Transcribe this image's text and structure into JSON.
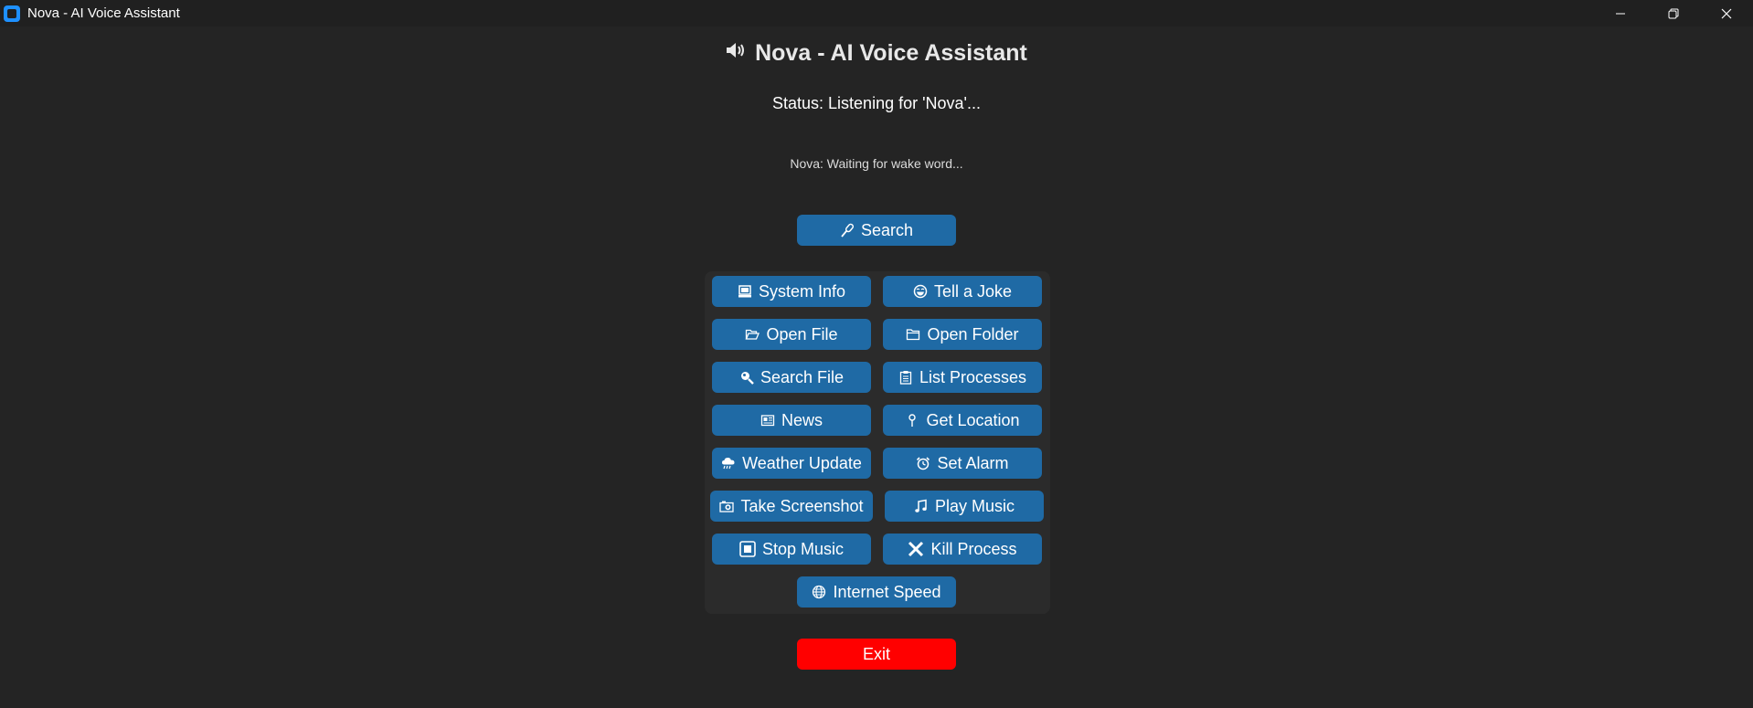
{
  "window": {
    "title": "Nova - AI Voice Assistant",
    "controls": [
      "minimize",
      "restore",
      "close"
    ]
  },
  "header": {
    "title": "Nova - AI Voice Assistant",
    "icon": "speaker-icon"
  },
  "status": "Status: Listening for 'Nova'...",
  "reply": "Nova: Waiting for wake word...",
  "search_button": {
    "label": "Search",
    "icon": "microphone-icon"
  },
  "commands": [
    {
      "label": "System Info",
      "icon": "computer-icon"
    },
    {
      "label": "Tell a Joke",
      "icon": "laughing-face-icon"
    },
    {
      "label": "Open File",
      "icon": "open-folder-icon"
    },
    {
      "label": "Open Folder",
      "icon": "folder-icon"
    },
    {
      "label": "Search File",
      "icon": "magnifier-icon"
    },
    {
      "label": "List Processes",
      "icon": "clipboard-icon"
    },
    {
      "label": "News",
      "icon": "newspaper-icon"
    },
    {
      "label": "Get Location",
      "icon": "pin-icon"
    },
    {
      "label": "Weather Update",
      "icon": "rain-cloud-icon"
    },
    {
      "label": "Set Alarm",
      "icon": "alarm-clock-icon"
    },
    {
      "label": "Take Screenshot",
      "icon": "camera-icon"
    },
    {
      "label": "Play Music",
      "icon": "music-note-icon"
    },
    {
      "label": "Stop Music",
      "icon": "stop-icon"
    },
    {
      "label": "Kill Process",
      "icon": "x-icon"
    },
    {
      "label": "Internet Speed",
      "icon": "globe-icon"
    }
  ],
  "exit_button": {
    "label": "Exit"
  },
  "colors": {
    "background": "#242424",
    "panel": "#2b2b2b",
    "button": "#1f6aa5",
    "exit": "#ff0000",
    "titlebar": "#202020"
  }
}
